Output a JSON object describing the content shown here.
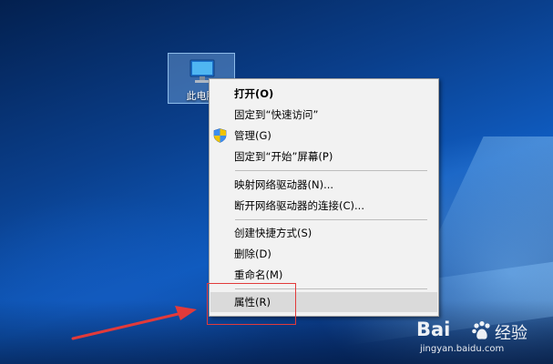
{
  "desktop": {
    "icon": {
      "label": "此电脑",
      "icon": "computer-icon"
    }
  },
  "context_menu": {
    "items": [
      {
        "label": "打开(O)",
        "bold": true
      },
      {
        "label": "固定到“快速访问”"
      },
      {
        "label": "管理(G)",
        "icon": "uac-shield-icon"
      },
      {
        "label": "固定到“开始”屏幕(P)"
      },
      {
        "label": "映射网络驱动器(N)..."
      },
      {
        "label": "断开网络驱动器的连接(C)..."
      },
      {
        "label": "创建快捷方式(S)"
      },
      {
        "label": "删除(D)"
      },
      {
        "label": "重命名(M)"
      },
      {
        "label": "属性(R)",
        "highlighted": true
      }
    ]
  },
  "annotation": {
    "box_color": "#e23a3a",
    "arrow_color": "#e23a3a",
    "points_to": "属性(R)"
  },
  "watermark": {
    "brand": "Bai",
    "product": "经验",
    "url": "jingyan.baidu.com"
  }
}
